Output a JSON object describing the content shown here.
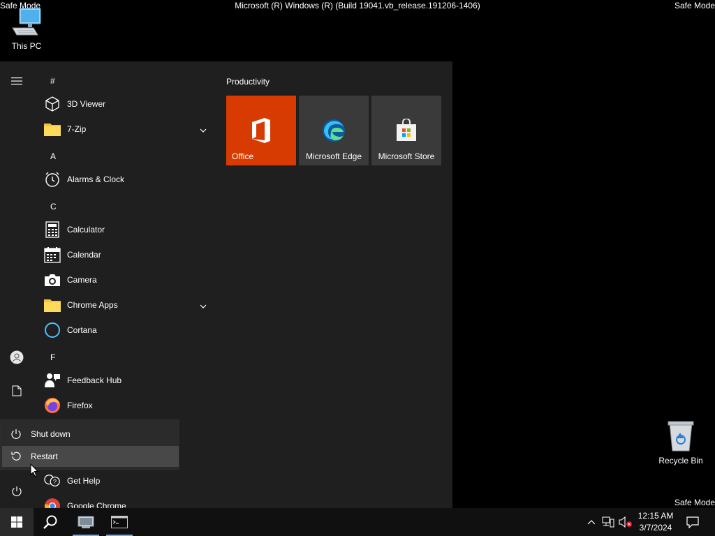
{
  "watermarks": {
    "top_left": "Safe Mode",
    "top_right": "Safe Mode",
    "bottom_right": "Safe Mode",
    "title": "Microsoft (R) Windows (R) (Build 19041.vb_release.191206-1406)"
  },
  "desktop": {
    "this_pc": "This PC",
    "recycle_bin": "Recycle Bin"
  },
  "start_menu": {
    "apps": [
      {
        "letter": "#"
      },
      {
        "name": "3D Viewer",
        "icon": "3d-cube-icon"
      },
      {
        "name": "7-Zip",
        "icon": "folder-icon",
        "expandable": true
      },
      {
        "letter": "A"
      },
      {
        "name": "Alarms & Clock",
        "icon": "alarm-clock-icon"
      },
      {
        "letter": "C"
      },
      {
        "name": "Calculator",
        "icon": "calculator-icon"
      },
      {
        "name": "Calendar",
        "icon": "calendar-icon"
      },
      {
        "name": "Camera",
        "icon": "camera-icon"
      },
      {
        "name": "Chrome Apps",
        "icon": "folder-icon",
        "expandable": true
      },
      {
        "name": "Cortana",
        "icon": "cortana-icon"
      },
      {
        "letter": "F"
      },
      {
        "name": "Feedback Hub",
        "icon": "feedback-hub-icon"
      },
      {
        "name": "Firefox",
        "icon": "firefox-icon"
      },
      {
        "name": "Get Help",
        "icon": "get-help-icon"
      },
      {
        "name": "Google Chrome",
        "icon": "chrome-icon"
      }
    ],
    "tiles_group": "Productivity",
    "tiles": [
      {
        "name": "Office",
        "icon": "office-icon"
      },
      {
        "name": "Microsoft Edge",
        "icon": "edge-icon"
      },
      {
        "name": "Microsoft Store",
        "icon": "store-icon"
      }
    ],
    "power_menu": {
      "shutdown": "Shut down",
      "restart": "Restart"
    }
  },
  "taskbar": {
    "clock_time": "12:15 AM",
    "clock_date": "3/7/2024"
  },
  "colors": {
    "start_bg": "#1f1f1f",
    "office_tile": "#d83b01",
    "tile_bg": "#3a3a3a",
    "taskbar_bg": "#101010",
    "accent": "#7ea6d8"
  }
}
